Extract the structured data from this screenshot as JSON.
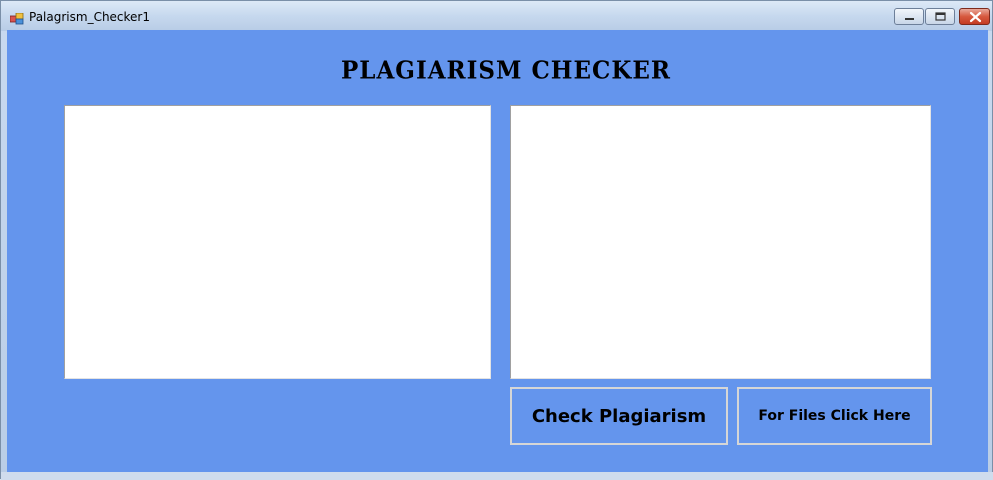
{
  "window": {
    "title": "Palagrism_Checker1",
    "controls": [
      "minimize",
      "maximize",
      "close"
    ]
  },
  "form": {
    "heading": "PLAGIARISM CHECKER",
    "text_left": "",
    "text_right": "",
    "check_button_label": "Check Plagiarism",
    "files_button_label": "For Files Click Here"
  },
  "colors": {
    "form_background": "#6495ed",
    "textbox_background": "#ffffff",
    "button_border": "#d6d6d6"
  },
  "icons": {
    "app": "app-window-icon",
    "minimize": "minimize-icon",
    "maximize": "maximize-icon",
    "close": "close-icon"
  }
}
